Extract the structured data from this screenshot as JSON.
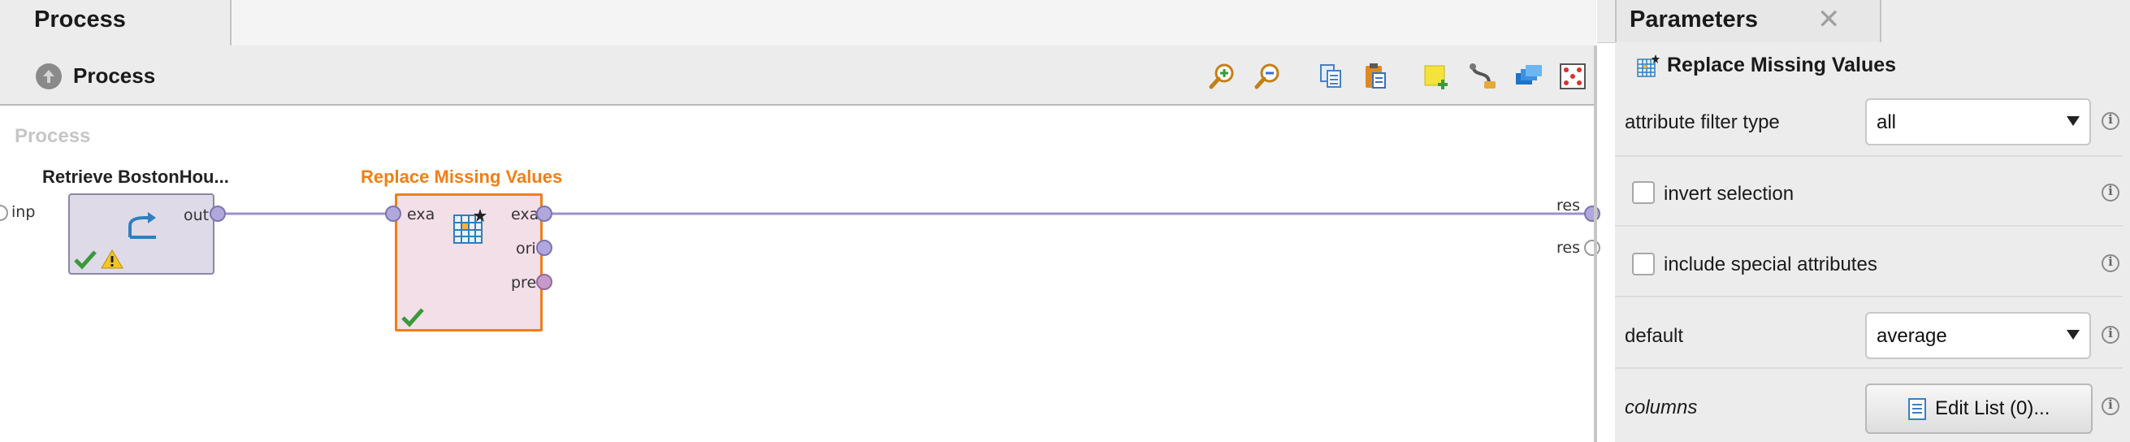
{
  "process_panel": {
    "tab_label": "Process",
    "breadcrumb": "Process",
    "canvas_title": "Process",
    "toolbar_icons": [
      "zoom-in-icon",
      "zoom-out-icon",
      "copy-icon",
      "paste-icon",
      "note-icon",
      "wire-icon",
      "layers-icon",
      "arrange-icon"
    ],
    "input_port_label": "inp",
    "result_ports": [
      "res",
      "res"
    ]
  },
  "operators": {
    "retrieve": {
      "title": "Retrieve BostonHou...",
      "output_port": "out",
      "status": [
        "ok",
        "warning"
      ]
    },
    "replace": {
      "title": "Replace Missing Values",
      "input_port": "exa",
      "output_ports": [
        "exa",
        "ori",
        "pre"
      ],
      "status": [
        "ok"
      ],
      "accent": "#f07f16"
    }
  },
  "parameters": {
    "tab_label": "Parameters",
    "operator_name": "Replace Missing Values",
    "rows": {
      "attribute_filter_type": {
        "label": "attribute filter type",
        "value": "all"
      },
      "invert_selection": {
        "label": "invert selection",
        "checked": false
      },
      "include_special": {
        "label": "include special attributes",
        "checked": false
      },
      "default": {
        "label": "default",
        "value": "average"
      },
      "columns": {
        "label": "columns",
        "button": "Edit List (0)..."
      }
    }
  },
  "colors": {
    "operator_fill": "#dedae8",
    "selected_fill": "#f3dfe8",
    "connection": "#9a93c7",
    "port_example": "#b0a8dc",
    "port_model": "#c69acb"
  }
}
